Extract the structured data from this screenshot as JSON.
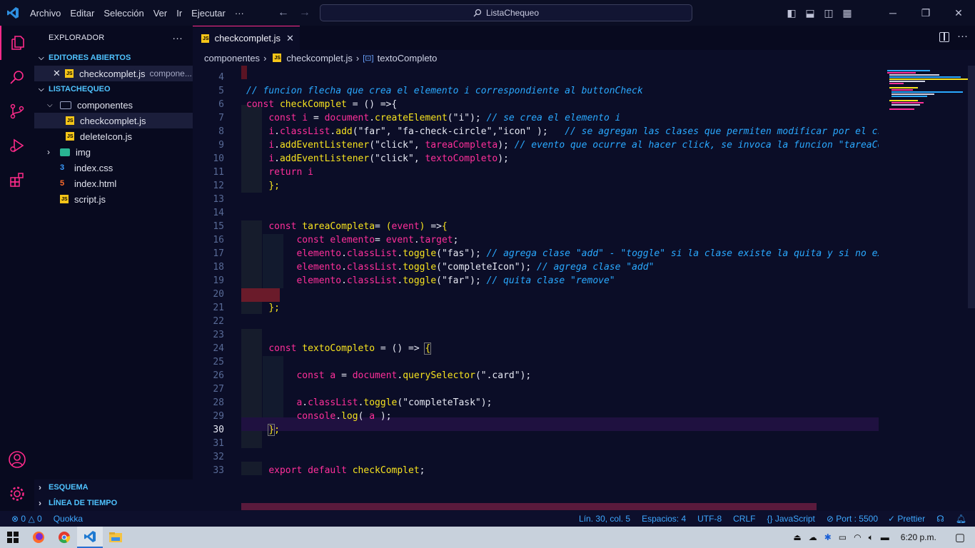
{
  "menu": {
    "items": [
      "Archivo",
      "Editar",
      "Selección",
      "Ver",
      "Ir",
      "Ejecutar",
      "···"
    ],
    "search_text": "ListaChequeo"
  },
  "sidebar": {
    "title": "EXPLORADOR",
    "more": "···",
    "open_editors_label": "EDITORES ABIERTOS",
    "open_file": "checkcomplet.js",
    "open_file_dir": "compone...",
    "project_label": "LISTACHEQUEO",
    "tree": {
      "componentes": "componentes",
      "checkcomplet": "checkcomplet.js",
      "deleteIcon": "deleteIcon.js",
      "img": "img",
      "indexcss": "index.css",
      "indexhtml": "index.html",
      "script": "script.js"
    },
    "outline_label": "ESQUEMA",
    "timeline_label": "LÍNEA DE TIEMPO"
  },
  "tab": {
    "label": "checkcomplet.js",
    "icon_text": "JS",
    "close": "✕"
  },
  "breadcrumb": {
    "folder": "componentes",
    "file": "checkcomplet.js",
    "symbol": "textoCompleto"
  },
  "code": {
    "line_numbers": [
      "4",
      "5",
      "6",
      "7",
      "8",
      "9",
      "10",
      "11",
      "12",
      "13",
      "14",
      "15",
      "16",
      "17",
      "18",
      "19",
      "20",
      "21",
      "22",
      "23",
      "24",
      "25",
      "26",
      "27",
      "28",
      "29",
      "30",
      "31",
      "32",
      "33"
    ]
  },
  "statusbar": {
    "errors": "0",
    "warnings": "0",
    "quokka": "Quokka",
    "position": "Lín. 30, col. 5",
    "spaces": "Espacios: 4",
    "encoding": "UTF-8",
    "eol": "CRLF",
    "language": "JavaScript",
    "port": "Port : 5500",
    "prettier": "Prettier"
  },
  "taskbar": {
    "time": "6:20 p.m."
  },
  "colors": {
    "accent": "#ff2a8a",
    "comment": "#2aa9ff",
    "function": "#f7e31f",
    "keyword": "#ff2f9a"
  }
}
